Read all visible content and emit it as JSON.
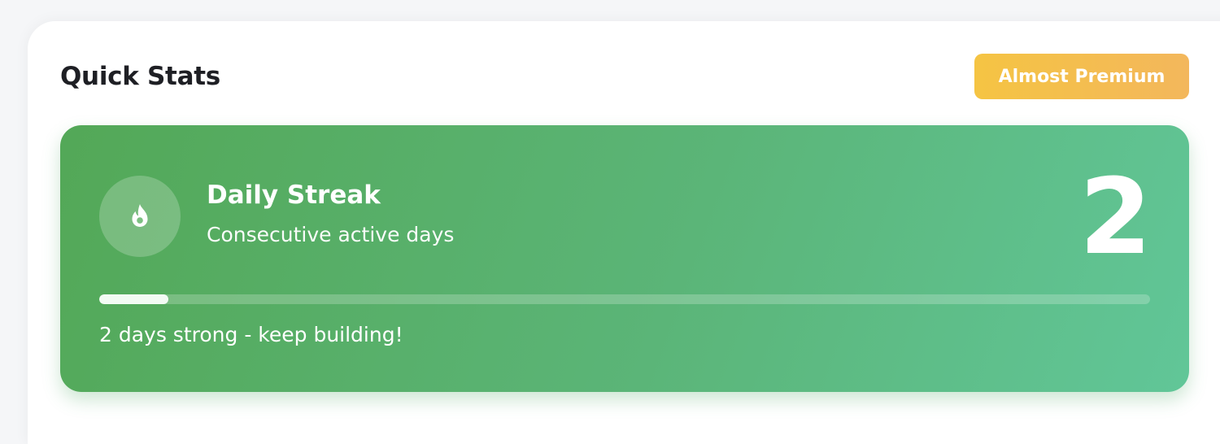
{
  "quick_stats": {
    "title": "Quick Stats",
    "badge_label": "Almost Premium",
    "badge_colors": [
      "#f5c443",
      "#f3b75c"
    ]
  },
  "streak_card": {
    "icon": "flame-icon",
    "title": "Daily Streak",
    "subtitle": "Consecutive active days",
    "count": "2",
    "progress_fraction": 0.066,
    "caption": "2 days strong - keep building!",
    "gradient_colors": [
      "#53a857",
      "#61c698"
    ]
  }
}
